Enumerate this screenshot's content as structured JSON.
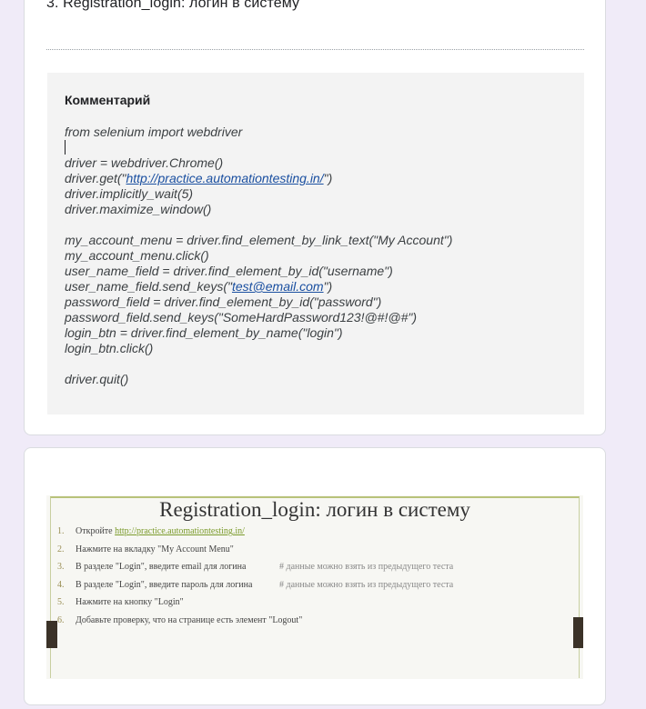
{
  "question": {
    "title": "3. Registration_login: логин в систему"
  },
  "comment": {
    "heading": "Комментарий",
    "lines": [
      {
        "text": "from selenium import webdriver"
      },
      {
        "caret": true
      },
      {
        "text": "driver = webdriver.Chrome()"
      },
      {
        "pre": "driver.get(\"",
        "link": "http://practice.automationtesting.in/",
        "post": "\")"
      },
      {
        "text": "driver.implicitly_wait(5)"
      },
      {
        "text": "driver.maximize_window()"
      },
      {
        "text": ""
      },
      {
        "text": "my_account_menu = driver.find_element_by_link_text(\"My Account\")"
      },
      {
        "text": "my_account_menu.click()"
      },
      {
        "text": "user_name_field = driver.find_element_by_id(\"username\")"
      },
      {
        "pre": "user_name_field.send_keys(\"",
        "link": "test@email.com",
        "post": "\")"
      },
      {
        "text": "password_field = driver.find_element_by_id(\"password\")"
      },
      {
        "text": "password_field.send_keys(\"SomeHardPassword123!@#!@#\")"
      },
      {
        "text": "login_btn = driver.find_element_by_name(\"login\")"
      },
      {
        "text": "login_btn.click()"
      },
      {
        "text": ""
      },
      {
        "text": "driver.quit()"
      }
    ]
  },
  "slide": {
    "title": "Registration_login: логин в систему",
    "items": [
      {
        "num": "1.",
        "pre": "Откройте ",
        "link": "http://practice.automationtesting.in/",
        "post": "",
        "comment": ""
      },
      {
        "num": "2.",
        "pre": "Нажмите на вкладку \"My Account Menu\"",
        "link": "",
        "post": "",
        "comment": ""
      },
      {
        "num": "3.",
        "pre": "В разделе \"Login\", введите email для логина",
        "link": "",
        "post": "",
        "comment": "# данные можно взять из предыдущего теста"
      },
      {
        "num": "4.",
        "pre": "В разделе \"Login\", введите пароль для логина",
        "link": "",
        "post": "",
        "comment": "# данные можно взять из предыдущего теста"
      },
      {
        "num": "5.",
        "pre": "Нажмите на кнопку \"Login\"",
        "link": "",
        "post": "",
        "comment": ""
      },
      {
        "num": "6.",
        "pre": "Добавьте проверку, что на странице есть элемент \"Logout\"",
        "link": "",
        "post": "",
        "comment": ""
      }
    ]
  }
}
